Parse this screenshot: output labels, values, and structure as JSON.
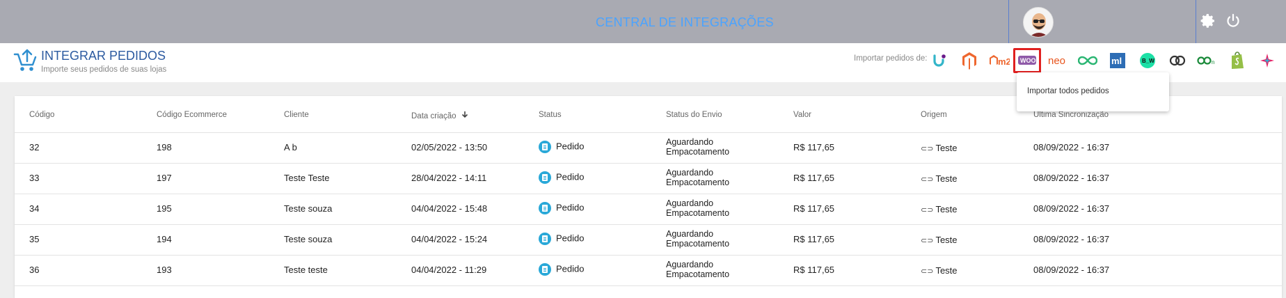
{
  "topbar": {
    "title": "CENTRAL DE INTEGRAÇÕES",
    "icons": [
      "avatar",
      "gear-icon",
      "power-icon"
    ]
  },
  "header": {
    "title": "INTEGRAR PEDIDOS",
    "subtitle": "Importe seus pedidos de suas lojas",
    "import_label": "Importar pedidos de:",
    "platforms": [
      {
        "name": "u-platform-icon",
        "label": ""
      },
      {
        "name": "magento-icon",
        "label": ""
      },
      {
        "name": "magento2-icon",
        "label": "m2"
      },
      {
        "name": "woocommerce-icon",
        "label": "woo",
        "selected": true
      },
      {
        "name": "neo-icon",
        "label": "neo"
      },
      {
        "name": "infinity-icon",
        "label": ""
      },
      {
        "name": "mercadolivre-icon",
        "label": "ml"
      },
      {
        "name": "bw-icon",
        "label": "B_W"
      },
      {
        "name": "link-icon",
        "label": ""
      },
      {
        "name": "loja-integrada-icon",
        "label": ""
      },
      {
        "name": "shopify-icon",
        "label": ""
      },
      {
        "name": "star-platform-icon",
        "label": ""
      }
    ]
  },
  "dropdown": {
    "item": "Importar todos pedidos"
  },
  "table": {
    "columns": [
      "Código",
      "Código Ecommerce",
      "Cliente",
      "Data criação",
      "Status",
      "Status do Envio",
      "Valor",
      "Origem",
      "Última Sincronização"
    ],
    "rows": [
      {
        "codigo": "32",
        "ecommerce": "198",
        "cliente": "A b",
        "data": "02/05/2022 - 13:50",
        "status": "Pedido",
        "envio1": "Aguardando",
        "envio2": "Empacotamento",
        "valor": "R$ 117,65",
        "origem": "Teste",
        "sync": "08/09/2022 - 16:37"
      },
      {
        "codigo": "33",
        "ecommerce": "197",
        "cliente": "Teste Teste",
        "data": "28/04/2022 - 14:11",
        "status": "Pedido",
        "envio1": "Aguardando",
        "envio2": "Empacotamento",
        "valor": "R$ 117,65",
        "origem": "Teste",
        "sync": "08/09/2022 - 16:37"
      },
      {
        "codigo": "34",
        "ecommerce": "195",
        "cliente": "Teste souza",
        "data": "04/04/2022 - 15:48",
        "status": "Pedido",
        "envio1": "Aguardando",
        "envio2": "Empacotamento",
        "valor": "R$ 117,65",
        "origem": "Teste",
        "sync": "08/09/2022 - 16:37"
      },
      {
        "codigo": "35",
        "ecommerce": "194",
        "cliente": "Teste souza",
        "data": "04/04/2022 - 15:24",
        "status": "Pedido",
        "envio1": "Aguardando",
        "envio2": "Empacotamento",
        "valor": "R$ 117,65",
        "origem": "Teste",
        "sync": "08/09/2022 - 16:37"
      },
      {
        "codigo": "36",
        "ecommerce": "193",
        "cliente": "Teste teste",
        "data": "04/04/2022 - 11:29",
        "status": "Pedido",
        "envio1": "Aguardando",
        "envio2": "Empacotamento",
        "valor": "R$ 117,65",
        "origem": "Teste",
        "sync": "08/09/2022 - 16:37"
      }
    ]
  },
  "colors": {
    "topbar": "#a9aab2",
    "title_blue": "#2c5aa0",
    "status_blue": "#29a8d8",
    "selected_border": "#e02020"
  }
}
